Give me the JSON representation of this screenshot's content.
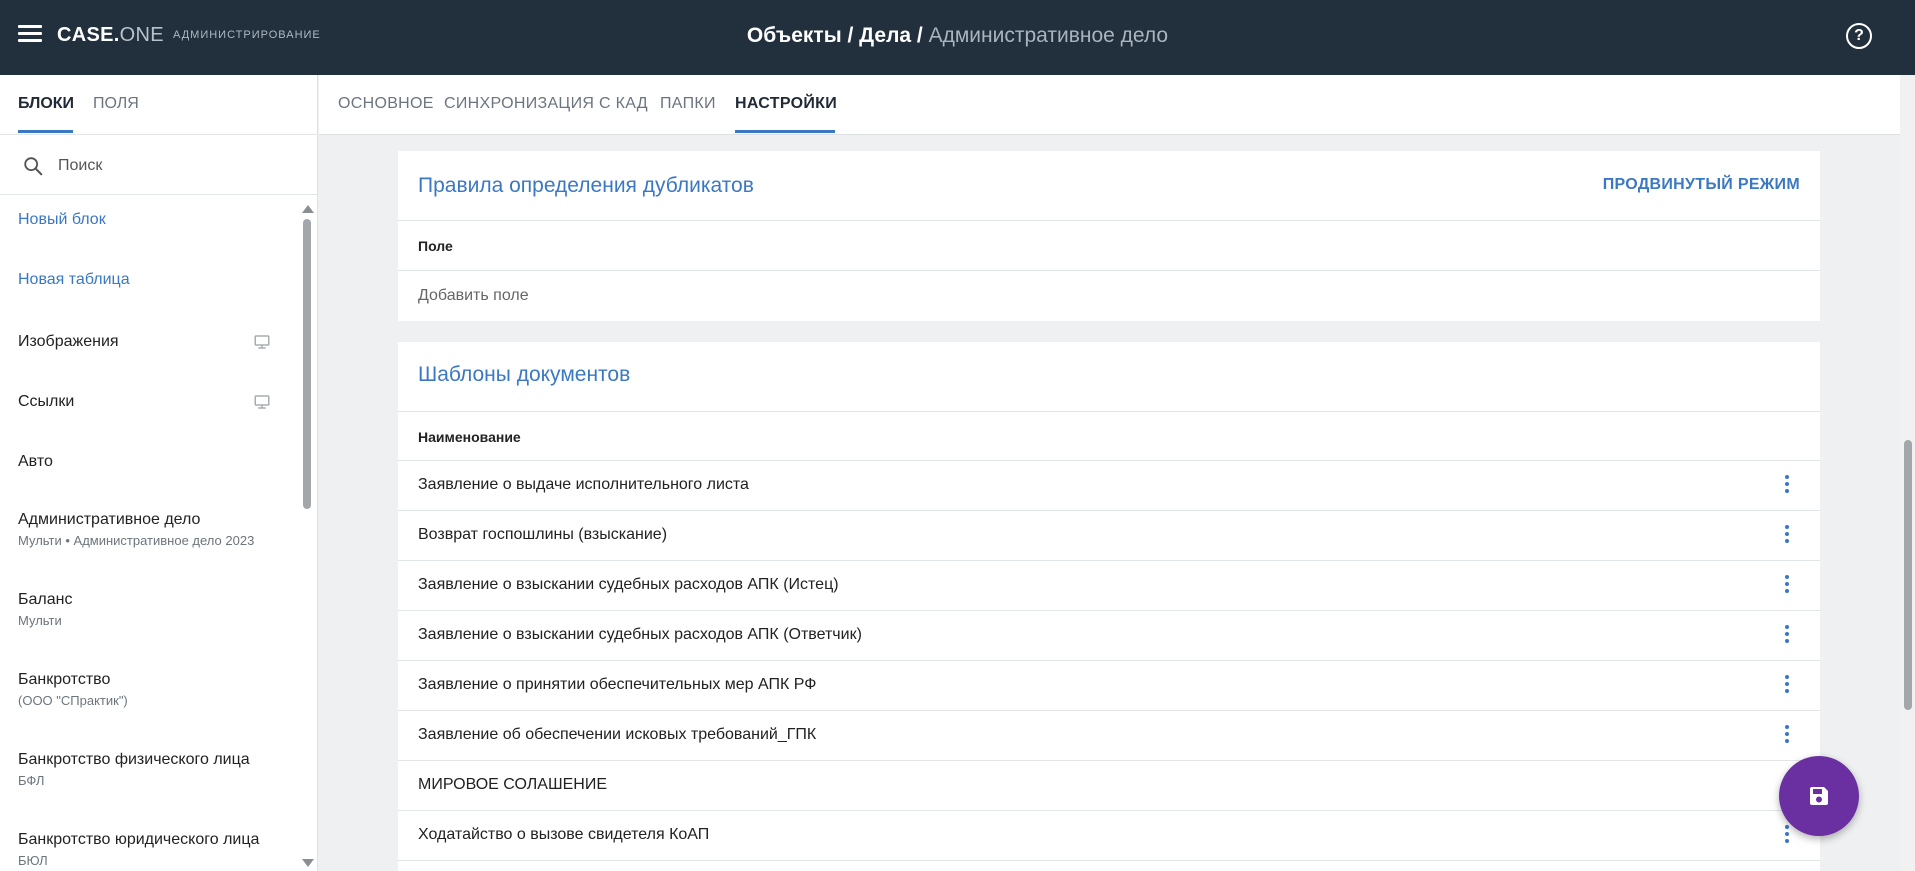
{
  "app": {
    "brand_main": "CASE.",
    "brand_accent": "ONE",
    "brand_sub": "АДМИНИСТРИРОВАНИЕ",
    "help_label": "?"
  },
  "breadcrumb": {
    "part1": "Объекты",
    "sep1": " / ",
    "part2": "Дела",
    "sep2": " / ",
    "current": "Административное дело"
  },
  "sidebar": {
    "tabs": [
      {
        "label": "БЛОКИ",
        "active": true
      },
      {
        "label": "ПОЛЯ",
        "active": false
      }
    ],
    "search_placeholder": "Поиск",
    "items": [
      {
        "label": "Новый блок",
        "sub": "",
        "link": true,
        "icon": ""
      },
      {
        "label": "Новая таблица",
        "sub": "",
        "link": true,
        "icon": ""
      },
      {
        "label": "Изображения",
        "sub": "",
        "link": false,
        "icon": "monitor-icon"
      },
      {
        "label": "Ссылки",
        "sub": "",
        "link": false,
        "icon": "monitor-icon"
      },
      {
        "label": "Авто",
        "sub": "",
        "link": false,
        "icon": ""
      },
      {
        "label": "Административное дело",
        "sub": "Мульти • Административное дело 2023",
        "link": false,
        "icon": ""
      },
      {
        "label": "Баланс",
        "sub": "Мульти",
        "link": false,
        "icon": ""
      },
      {
        "label": "Банкротство",
        "sub": "(ООО \"СПрактик\")",
        "link": false,
        "icon": ""
      },
      {
        "label": "Банкротство физического лица",
        "sub": "БФЛ",
        "link": false,
        "icon": ""
      },
      {
        "label": "Банкротство юридического лица",
        "sub": "БЮЛ",
        "link": false,
        "icon": ""
      }
    ]
  },
  "main_tabs": [
    {
      "label": "ОСНОВНОЕ",
      "active": false
    },
    {
      "label": "СИНХРОНИЗАЦИЯ С КАД",
      "active": false
    },
    {
      "label": "ПАПКИ",
      "active": false
    },
    {
      "label": "НАСТРОЙКИ",
      "active": true
    }
  ],
  "duplicates": {
    "title": "Правила определения дубликатов",
    "action": "ПРОДВИНУТЫЙ РЕЖИМ",
    "column": "Поле",
    "add_field": "Добавить поле"
  },
  "templates": {
    "title": "Шаблоны документов",
    "column": "Наименование",
    "rows": [
      "Заявление о выдаче исполнительного листа",
      "Возврат госпошлины (взыскание)",
      "Заявление о взыскании судебных расходов АПК (Истец)",
      "Заявление о взыскании судебных расходов АПК (Ответчик)",
      "Заявление о принятии обеспечительных мер АПК РФ",
      "Заявление об обеспечении исковых требований_ГПК",
      "МИРОВОЕ СОЛАШЕНИЕ",
      "Ходатайство о вызове свидетеля КоАП"
    ]
  },
  "colors": {
    "topbar": "#22303d",
    "accent": "#3b78c4",
    "fab": "#6a2fa0"
  },
  "fab_icon": "save-icon"
}
